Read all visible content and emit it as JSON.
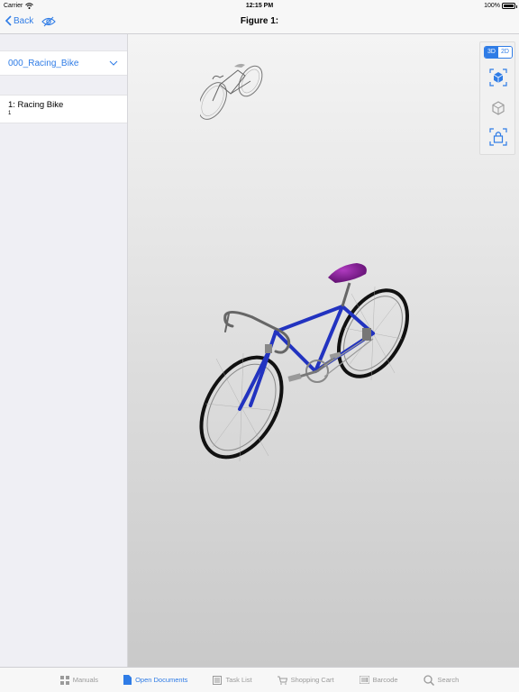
{
  "status": {
    "carrier": "Carrier",
    "time": "12:15 PM",
    "battery": "100%",
    "battery_level": 1.0
  },
  "nav": {
    "back_label": "Back",
    "title": "Figure 1:"
  },
  "sidebar": {
    "document": "000_Racing_Bike",
    "items": [
      {
        "title": "1: Racing Bike",
        "sub": "1"
      }
    ]
  },
  "viewer": {
    "mode_3d": "3D",
    "mode_2d": "2D",
    "active_mode": "3D",
    "tools": [
      "3d-cube-icon",
      "box-outline-icon",
      "lock-icon"
    ]
  },
  "tabs": [
    {
      "label": "Manuals",
      "icon": "grid-icon",
      "active": false
    },
    {
      "label": "Open Documents",
      "icon": "document-icon",
      "active": true
    },
    {
      "label": "Task List",
      "icon": "checklist-icon",
      "active": false
    },
    {
      "label": "Shopping Cart",
      "icon": "cart-icon",
      "active": false
    },
    {
      "label": "Barcode",
      "icon": "barcode-icon",
      "active": false
    },
    {
      "label": "Search",
      "icon": "search-icon",
      "active": false
    }
  ],
  "colors": {
    "accent": "#2f7ce6",
    "frame": "#2233c0",
    "saddle": "#7a1a8a"
  }
}
